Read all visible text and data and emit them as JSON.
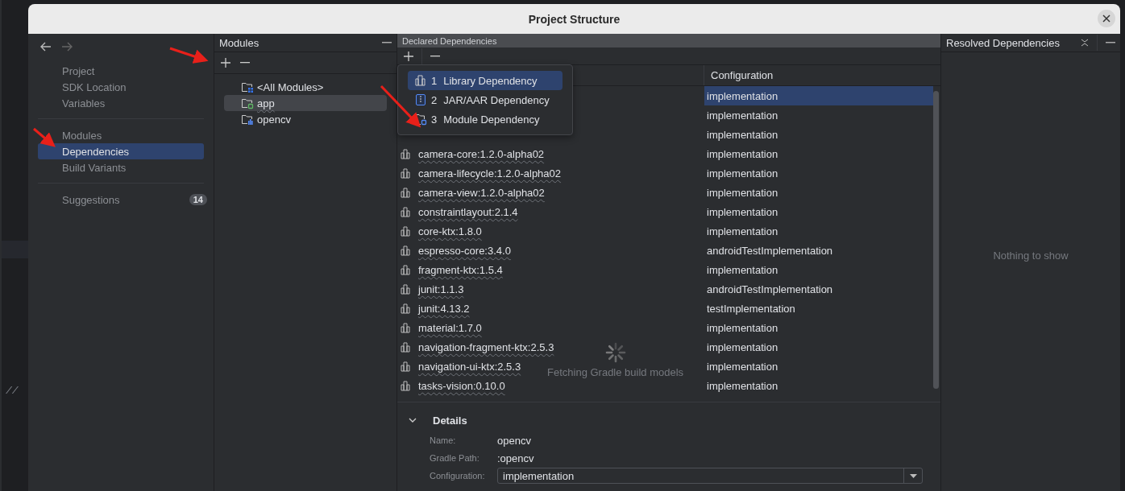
{
  "editor": {
    "comment": "//"
  },
  "window": {
    "title": "Project Structure"
  },
  "nav": {
    "sections": [
      [
        {
          "label": "Project",
          "selected": false
        },
        {
          "label": "SDK Location",
          "selected": false
        },
        {
          "label": "Variables",
          "selected": false
        }
      ],
      [
        {
          "label": "Modules",
          "selected": false
        },
        {
          "label": "Dependencies",
          "selected": true
        },
        {
          "label": "Build Variants",
          "selected": false
        }
      ],
      [
        {
          "label": "Suggestions",
          "selected": false,
          "count": "14"
        }
      ]
    ]
  },
  "modules_panel": {
    "title": "Modules",
    "items": [
      {
        "label": "<All Modules>",
        "kind": "all",
        "selected": false
      },
      {
        "label": "app",
        "kind": "app",
        "selected": true
      },
      {
        "label": "opencv",
        "kind": "library",
        "selected": false
      }
    ]
  },
  "declared": {
    "title": "Declared Dependencies",
    "column_2": "Configuration",
    "rows": [
      {
        "configuration": "implementation",
        "selected": true
      },
      {
        "configuration": "implementation",
        "selected": false
      },
      {
        "configuration": "implementation",
        "selected": false
      },
      {
        "name": "camera-core:1.2.0-alpha02",
        "configuration": "implementation",
        "selected": false
      },
      {
        "name": "camera-lifecycle:1.2.0-alpha02",
        "configuration": "implementation",
        "selected": false
      },
      {
        "name": "camera-view:1.2.0-alpha02",
        "configuration": "implementation",
        "selected": false
      },
      {
        "name": "constraintlayout:2.1.4",
        "configuration": "implementation",
        "selected": false
      },
      {
        "name": "core-ktx:1.8.0",
        "configuration": "implementation",
        "selected": false
      },
      {
        "name": "espresso-core:3.4.0",
        "configuration": "androidTestImplementation",
        "selected": false
      },
      {
        "name": "fragment-ktx:1.5.4",
        "configuration": "implementation",
        "selected": false
      },
      {
        "name": "junit:1.1.3",
        "configuration": "androidTestImplementation",
        "selected": false
      },
      {
        "name": "junit:4.13.2",
        "configuration": "testImplementation",
        "selected": false
      },
      {
        "name": "material:1.7.0",
        "configuration": "implementation",
        "selected": false
      },
      {
        "name": "navigation-fragment-ktx:2.5.3",
        "configuration": "implementation",
        "selected": false
      },
      {
        "name": "navigation-ui-ktx:2.5.3",
        "configuration": "implementation",
        "selected": false
      },
      {
        "name": "tasks-vision:0.10.0",
        "configuration": "implementation",
        "selected": false
      }
    ],
    "add_menu": [
      {
        "number": "1",
        "label": "Library Dependency",
        "kind": "library",
        "selected": true
      },
      {
        "number": "2",
        "label": "JAR/AAR Dependency",
        "kind": "jar",
        "selected": false
      },
      {
        "number": "3",
        "label": "Module Dependency",
        "kind": "module",
        "selected": false
      }
    ],
    "loading": "Fetching Gradle build models",
    "details": {
      "title": "Details",
      "expanded": true,
      "fields": [
        {
          "label": "Name:",
          "value": "opencv"
        },
        {
          "label": "Gradle Path:",
          "value": ":opencv"
        }
      ],
      "configuration": {
        "label": "Configuration:",
        "value": "implementation"
      }
    }
  },
  "resolved": {
    "title": "Resolved Dependencies",
    "empty": "Nothing to show"
  }
}
